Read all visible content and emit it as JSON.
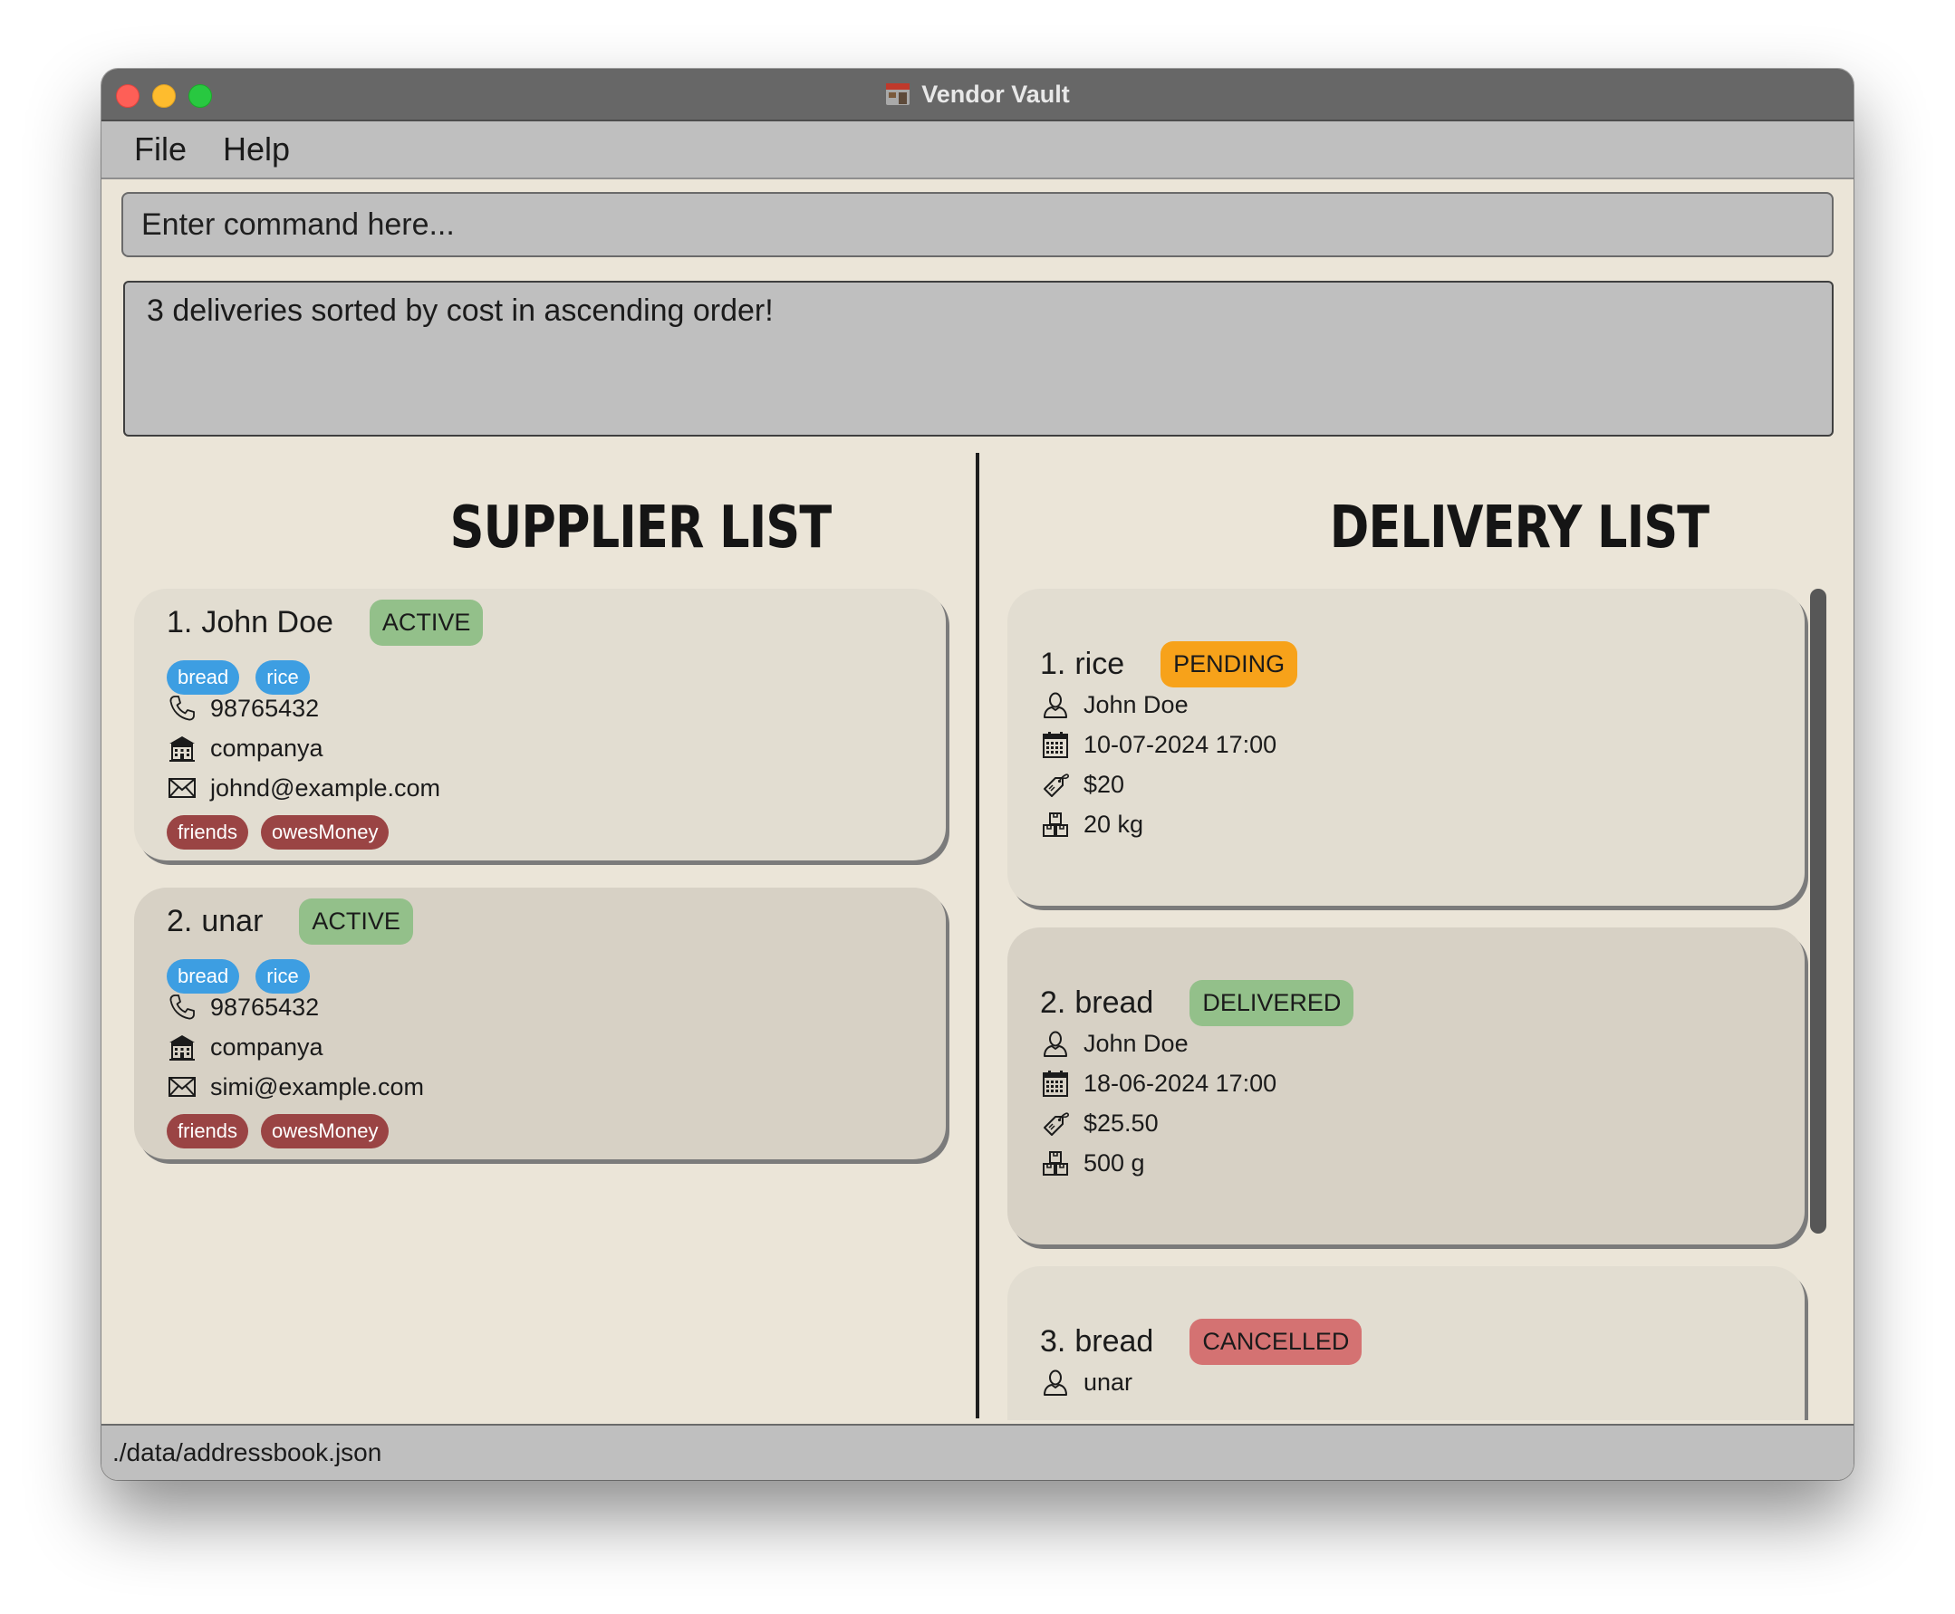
{
  "window": {
    "title": "Vendor Vault"
  },
  "menu": [
    "File",
    "Help"
  ],
  "command": {
    "placeholder": "Enter command here..."
  },
  "result": {
    "message": "3 deliveries sorted by cost in ascending order!"
  },
  "supplier_panel": {
    "title": "SUPPLIER LIST",
    "suppliers": [
      {
        "index": "1.",
        "name": "John Doe",
        "status": "ACTIVE",
        "products": [
          "bread",
          "rice"
        ],
        "phone": "98765432",
        "company": "companya",
        "email": "johnd@example.com",
        "tags": [
          "friends",
          "owesMoney"
        ]
      },
      {
        "index": "2.",
        "name": "unar",
        "status": "ACTIVE",
        "products": [
          "bread",
          "rice"
        ],
        "phone": "98765432",
        "company": "companya",
        "email": "simi@example.com",
        "tags": [
          "friends",
          "owesMoney"
        ]
      }
    ]
  },
  "delivery_panel": {
    "title": "DELIVERY LIST",
    "deliveries": [
      {
        "index": "1.",
        "product": "rice",
        "status": "PENDING",
        "supplier": "John Doe",
        "date": "10-07-2024 17:00",
        "cost": "$20",
        "quantity": "20 kg"
      },
      {
        "index": "2.",
        "product": "bread",
        "status": "DELIVERED",
        "supplier": "John Doe",
        "date": "18-06-2024 17:00",
        "cost": "$25.50",
        "quantity": "500 g"
      },
      {
        "index": "3.",
        "product": "bread",
        "status": "CANCELLED",
        "supplier": "unar"
      }
    ]
  },
  "statusbar": {
    "path": "./data/addressbook.json"
  },
  "colors": {
    "background": "#ebe5d8",
    "active": "#93c08a",
    "pending": "#f7a21a",
    "cancelled": "#d47272",
    "product_tag": "#3d9ee2",
    "tag": "#9a4444"
  },
  "icons": [
    "phone-icon",
    "building-icon",
    "mail-icon",
    "person-icon",
    "calendar-icon",
    "price-tag-icon",
    "boxes-icon"
  ]
}
